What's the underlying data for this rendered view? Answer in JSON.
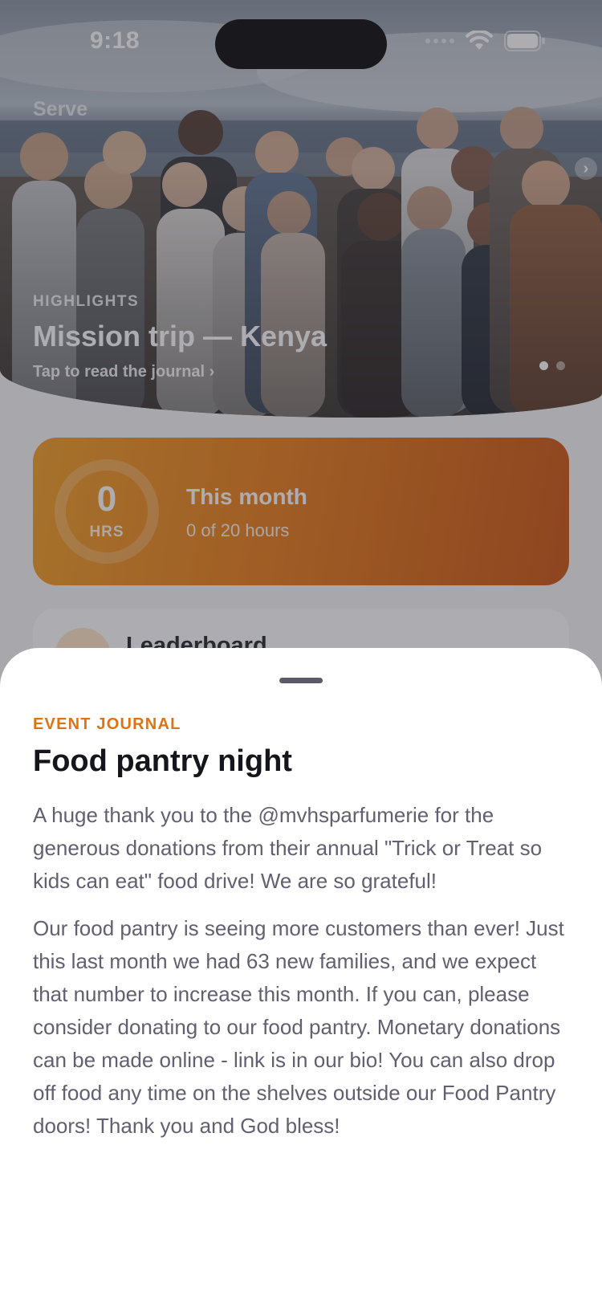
{
  "status_bar": {
    "time": "9:18"
  },
  "app": {
    "brand": "Serve"
  },
  "hero": {
    "kicker": "HIGHLIGHTS",
    "title": "Mission trip — Kenya",
    "link": "Tap to read the journal ›",
    "next_icon": "chevron-right-icon",
    "pages": 2,
    "active_page": 1
  },
  "hours_card": {
    "value": "0",
    "unit": "HRS",
    "title": "This month",
    "subtitle": "0 of 20 hours",
    "progress": 0
  },
  "leaderboard": {
    "title": "Leaderboard"
  },
  "sheet": {
    "kicker": "EVENT JOURNAL",
    "title": "Food pantry night",
    "paragraphs": [
      "A huge thank you to the @mvhsparfumerie for the generous donations from their annual \"Trick or Treat so kids can eat\" food drive! We are so grateful!",
      "Our food pantry is seeing more customers than ever! Just this last month we had 63 new families, and we expect that number to increase this month. If you can, please consider donating to our food pantry. Monetary donations can be made online - link is in our bio! You can also drop off food any time on the shelves outside our Food Pantry doors! Thank you and God bless!"
    ]
  },
  "colors": {
    "accent": "#dd7414",
    "card_gradient_start": "#f39a1a",
    "card_gradient_end": "#c94d06"
  }
}
